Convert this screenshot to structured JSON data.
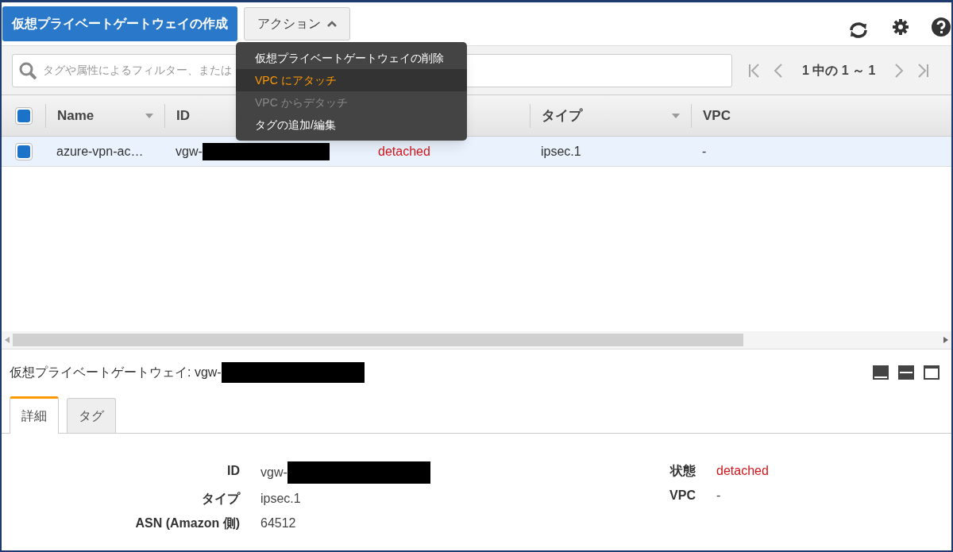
{
  "toolbar": {
    "create_button": "仮想プライベートゲートウェイの作成",
    "actions_button": "アクション"
  },
  "actions_menu": [
    {
      "label": "仮想プライベートゲートウェイの削除",
      "selected": false,
      "disabled": false
    },
    {
      "label": "VPC にアタッチ",
      "selected": true,
      "disabled": false
    },
    {
      "label": "VPC からデタッチ",
      "selected": false,
      "disabled": true
    },
    {
      "label": "タグの追加/編集",
      "selected": false,
      "disabled": false
    }
  ],
  "filter": {
    "placeholder": "タグや属性によるフィルター、または"
  },
  "pagination": "1 中の 1 ～ 1",
  "table": {
    "all_selected": true,
    "columns": [
      {
        "label": "Name",
        "sortable": true
      },
      {
        "label": "ID",
        "sortable": false
      },
      {
        "label": "タイプ",
        "sortable": true
      },
      {
        "label": "VPC",
        "sortable": false
      }
    ],
    "rows": [
      {
        "selected": true,
        "name": "azure-vpn-ac…",
        "id": "vgw-",
        "column_3": "detached",
        "type": "ipsec.1",
        "vpc": "-"
      }
    ]
  },
  "detail": {
    "title": "仮想プライベートゲートウェイ: vgw-",
    "tabs": [
      {
        "label": "詳細",
        "selected": true
      },
      {
        "label": "タグ",
        "selected": false
      }
    ],
    "left_fields": [
      {
        "label": "ID",
        "value": "vgw-",
        "redacted": true
      },
      {
        "label": "タイプ",
        "value": "ipsec.1",
        "redacted": false
      },
      {
        "label": "ASN (Amazon 側)",
        "value": "64512",
        "redacted": false
      }
    ],
    "right_fields": [
      {
        "label": "状態",
        "value": "detached",
        "kind": "status"
      },
      {
        "label": "VPC",
        "value": "-",
        "kind": "plain"
      }
    ]
  }
}
